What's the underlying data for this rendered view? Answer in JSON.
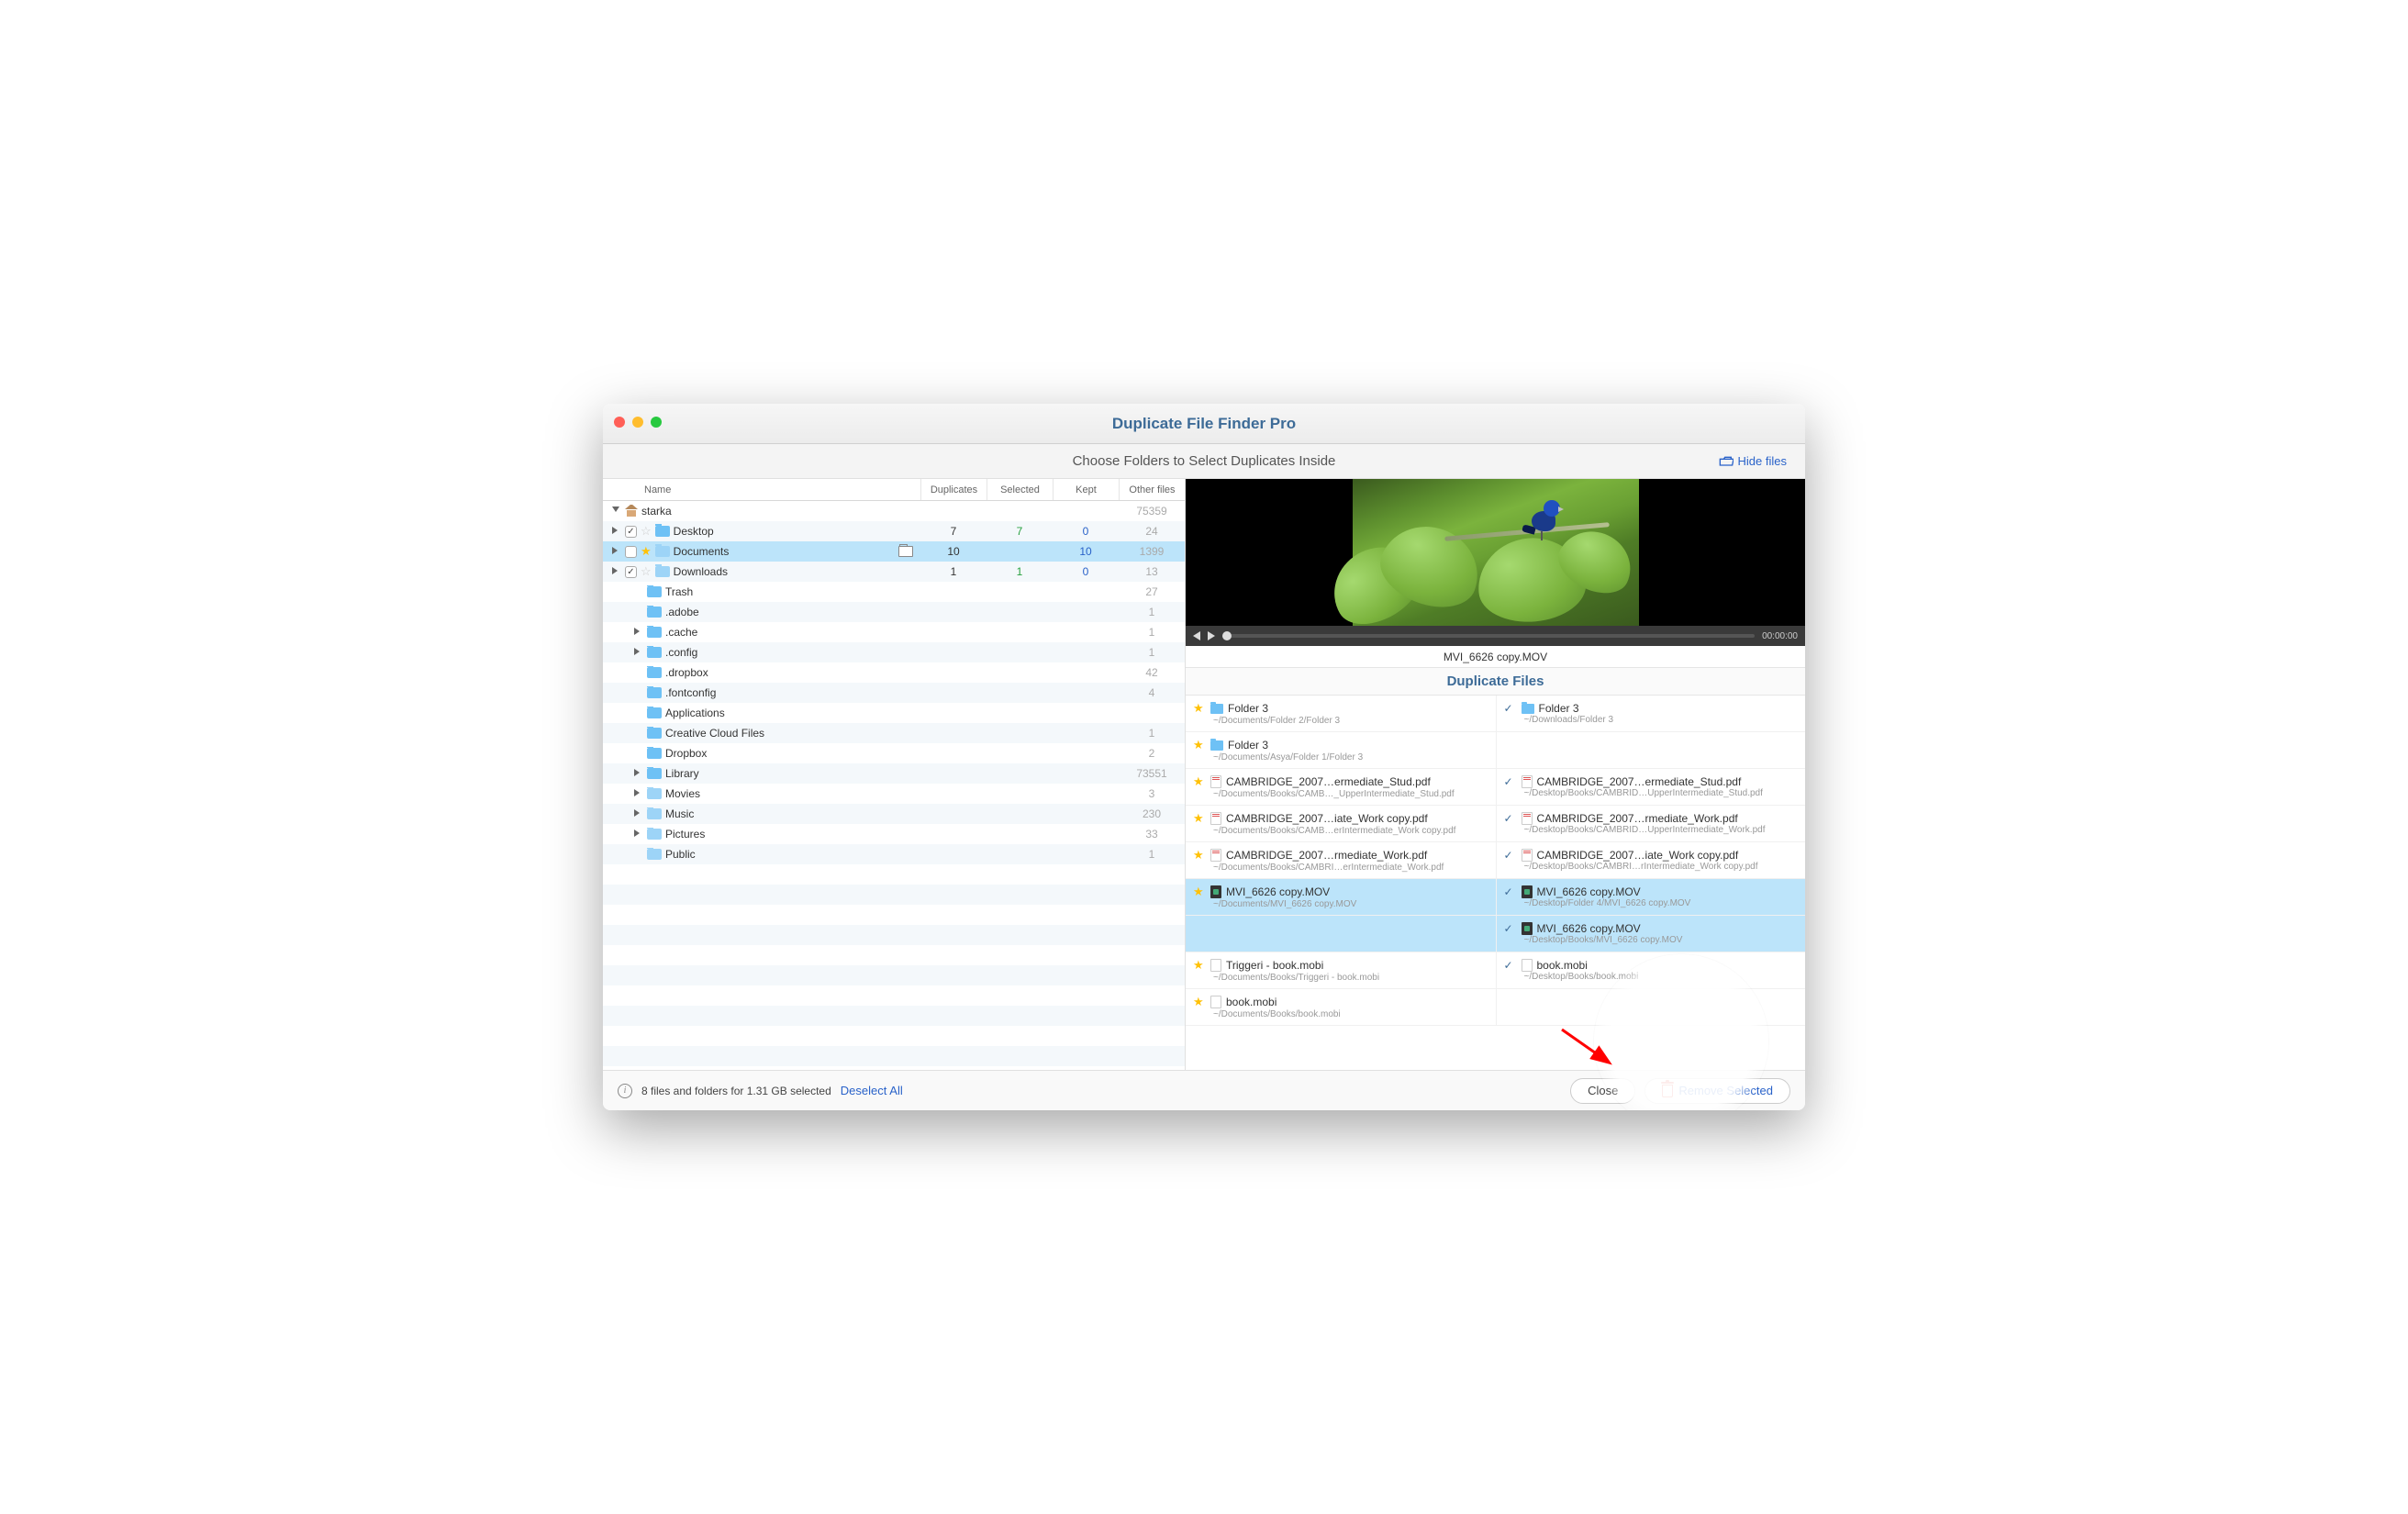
{
  "app": {
    "title": "Duplicate File Finder Pro"
  },
  "subheader": {
    "title": "Choose Folders to Select Duplicates Inside",
    "hide_files": "Hide files"
  },
  "columns": {
    "name": "Name",
    "duplicates": "Duplicates",
    "selected": "Selected",
    "kept": "Kept",
    "other": "Other files"
  },
  "tree": [
    {
      "name": "starka",
      "icon": "home",
      "disclosure": "down",
      "indent": 0,
      "other": "75359"
    },
    {
      "name": "Desktop",
      "icon": "folder",
      "disclosure": "right",
      "indent": 1,
      "checkbox": true,
      "checked": true,
      "star": "off",
      "dup": "7",
      "sel": "7",
      "sel_color": "green",
      "kept": "0",
      "kept_color": "blue",
      "other": "24"
    },
    {
      "name": "Documents",
      "icon": "folder-lt",
      "disclosure": "right",
      "indent": 1,
      "checkbox": true,
      "checked": false,
      "star": "on",
      "dup": "10",
      "sel": "",
      "kept": "10",
      "kept_color": "blue",
      "other": "1399",
      "other_color": "gray",
      "highlighted": true,
      "open_folder": true
    },
    {
      "name": "Downloads",
      "icon": "folder-lt",
      "disclosure": "right",
      "indent": 1,
      "checkbox": true,
      "checked": true,
      "star": "off",
      "dup": "1",
      "sel": "1",
      "sel_color": "green",
      "kept": "0",
      "kept_color": "blue",
      "other": "13"
    },
    {
      "name": "Trash",
      "icon": "folder",
      "indent": 2,
      "other": "27"
    },
    {
      "name": ".adobe",
      "icon": "folder",
      "indent": 2,
      "other": "1"
    },
    {
      "name": ".cache",
      "icon": "folder",
      "disclosure": "right",
      "indent": 2,
      "other": "1"
    },
    {
      "name": ".config",
      "icon": "folder",
      "disclosure": "right",
      "indent": 2,
      "other": "1"
    },
    {
      "name": ".dropbox",
      "icon": "folder",
      "indent": 2,
      "other": "42"
    },
    {
      "name": ".fontconfig",
      "icon": "folder",
      "indent": 2,
      "other": "4"
    },
    {
      "name": "Applications",
      "icon": "folder",
      "indent": 2,
      "other": ""
    },
    {
      "name": "Creative Cloud Files",
      "icon": "folder",
      "indent": 2,
      "other": "1"
    },
    {
      "name": "Dropbox",
      "icon": "folder",
      "indent": 2,
      "other": "2"
    },
    {
      "name": "Library",
      "icon": "folder",
      "disclosure": "right",
      "indent": 2,
      "other": "73551"
    },
    {
      "name": "Movies",
      "icon": "folder-lt",
      "disclosure": "right",
      "indent": 2,
      "other": "3"
    },
    {
      "name": "Music",
      "icon": "folder-lt",
      "disclosure": "right",
      "indent": 2,
      "other": "230"
    },
    {
      "name": "Pictures",
      "icon": "folder-lt",
      "disclosure": "right",
      "indent": 2,
      "other": "33"
    },
    {
      "name": "Public",
      "icon": "folder-lt",
      "indent": 2,
      "other": "1"
    }
  ],
  "playbar": {
    "time": "00:00:00"
  },
  "preview": {
    "filename": "MVI_6626 copy.MOV",
    "section_title": "Duplicate Files"
  },
  "duplicates": [
    {
      "left": {
        "mark": "star",
        "icon": "folder",
        "name": "Folder 3",
        "path": "~/Documents/Folder 2/Folder 3"
      },
      "right": {
        "mark": "check",
        "icon": "folder",
        "name": "Folder 3",
        "path": "~/Downloads/Folder 3"
      }
    },
    {
      "left": {
        "mark": "star",
        "icon": "folder",
        "name": "Folder 3",
        "path": "~/Documents/Asya/Folder 1/Folder 3"
      }
    },
    {
      "left": {
        "mark": "star",
        "icon": "pdf",
        "name": "CAMBRIDGE_2007…ermediate_Stud.pdf",
        "path": "~/Documents/Books/CAMB…_UpperIntermediate_Stud.pdf"
      },
      "right": {
        "mark": "check",
        "icon": "pdf",
        "name": "CAMBRIDGE_2007…ermediate_Stud.pdf",
        "path": "~/Desktop/Books/CAMBRID…UpperIntermediate_Stud.pdf"
      }
    },
    {
      "left": {
        "mark": "star",
        "icon": "pdf",
        "name": "CAMBRIDGE_2007…iate_Work copy.pdf",
        "path": "~/Documents/Books/CAMB…erIntermediate_Work copy.pdf"
      },
      "right": {
        "mark": "check",
        "icon": "pdf",
        "name": "CAMBRIDGE_2007…rmediate_Work.pdf",
        "path": "~/Desktop/Books/CAMBRID…UpperIntermediate_Work.pdf"
      }
    },
    {
      "left": {
        "mark": "star",
        "icon": "pdf",
        "name": "CAMBRIDGE_2007…rmediate_Work.pdf",
        "path": "~/Documents/Books/CAMBRI…erIntermediate_Work.pdf"
      },
      "right": {
        "mark": "check",
        "icon": "pdf",
        "name": "CAMBRIDGE_2007…iate_Work copy.pdf",
        "path": "~/Desktop/Books/CAMBRI…rIntermediate_Work copy.pdf"
      }
    },
    {
      "selected": true,
      "left": {
        "mark": "star",
        "icon": "mov",
        "name": "MVI_6626 copy.MOV",
        "path": "~/Documents/MVI_6626 copy.MOV"
      },
      "right": {
        "mark": "check",
        "icon": "mov",
        "name": "MVI_6626 copy.MOV",
        "path": "~/Desktop/Folder 4/MVI_6626 copy.MOV"
      }
    },
    {
      "selected": true,
      "right": {
        "mark": "check",
        "icon": "mov",
        "name": "MVI_6626 copy.MOV",
        "path": "~/Desktop/Books/MVI_6626 copy.MOV"
      }
    },
    {
      "left": {
        "mark": "star",
        "icon": "file",
        "name": "Triggeri - book.mobi",
        "path": "~/Documents/Books/Triggeri - book.mobi"
      },
      "right": {
        "mark": "check",
        "icon": "file",
        "name": "book.mobi",
        "path": "~/Desktop/Books/book.mobi"
      }
    },
    {
      "left": {
        "mark": "star",
        "icon": "file",
        "name": "book.mobi",
        "path": "~/Documents/Books/book.mobi"
      }
    }
  ],
  "footer": {
    "status": "8 files and folders for 1.31 GB selected",
    "deselect": "Deselect All",
    "close": "Close",
    "remove": "Remove Selected"
  }
}
